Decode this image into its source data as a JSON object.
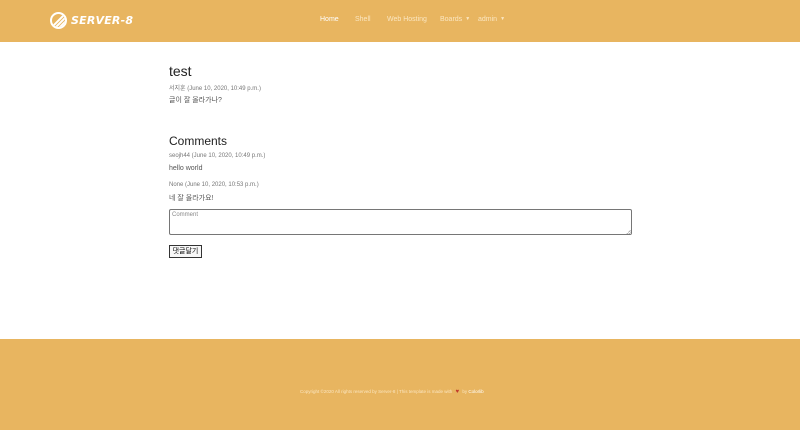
{
  "brand": {
    "name": "SERVER-8"
  },
  "nav": {
    "items": [
      {
        "label": "Home",
        "active": true
      },
      {
        "label": "Shell",
        "active": false
      },
      {
        "label": "Web Hosting",
        "active": false
      },
      {
        "label": "Boards",
        "active": false,
        "dropdown": true
      },
      {
        "label": "admin",
        "active": false,
        "dropdown": true
      }
    ]
  },
  "post": {
    "title": "test",
    "meta": "서지훈 (June 10, 2020, 10:49 p.m.)",
    "content": "글이 잘 올라가나?"
  },
  "comments": {
    "heading": "Comments",
    "list": [
      {
        "meta": "seojh44 (June 10, 2020, 10:49 p.m.)",
        "text": "hello world"
      },
      {
        "meta": "None (June 10, 2020, 10:53 p.m.)",
        "text": "네 잘 올라가요!"
      }
    ],
    "input_placeholder": "Comment",
    "input_value": "",
    "submit_label": "댓글달기"
  },
  "footer": {
    "copyright_prefix": "Copyright ©2020 All rights reserved by Server-8 | This template is made with",
    "copyright_by": "by",
    "link_label": "Colorlib"
  },
  "colors": {
    "header_bg": "#e8b560",
    "footer_bg": "#e8b560",
    "heart": "#c0392b"
  },
  "icons": {
    "logo": "server-stripes-logo-icon",
    "heart": "heart-icon",
    "caret": "chevron-down-icon"
  }
}
